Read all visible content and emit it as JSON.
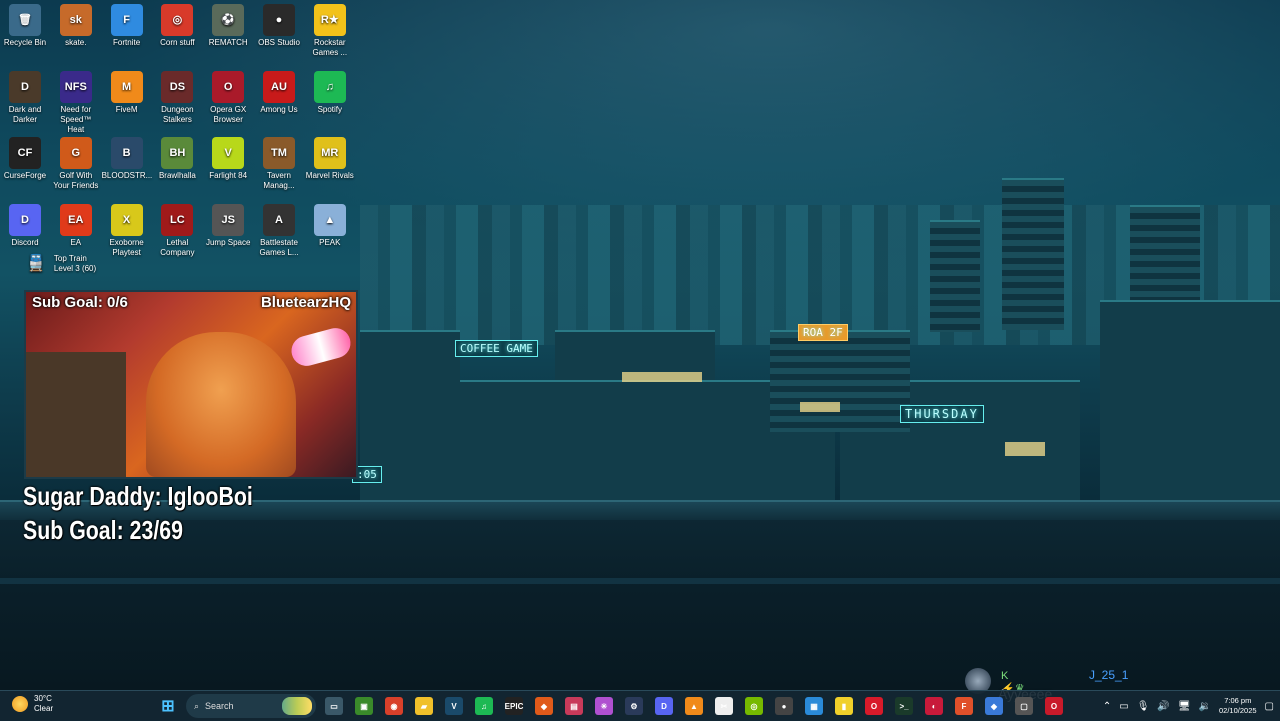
{
  "desktop": {
    "icons": [
      {
        "label": "Recycle Bin",
        "glyph": "🗑",
        "color": "#3a6a8a"
      },
      {
        "label": "skate.",
        "glyph": "sk",
        "color": "#c66a2a"
      },
      {
        "label": "Fortnite",
        "glyph": "F",
        "color": "#2f8be0"
      },
      {
        "label": "Corn stuff",
        "glyph": "◎",
        "color": "#d83a2a"
      },
      {
        "label": "REMATCH",
        "glyph": "⚽",
        "color": "#5a6a5a"
      },
      {
        "label": "OBS Studio",
        "glyph": "●",
        "color": "#2a2a2a"
      },
      {
        "label": "Rockstar Games ...",
        "glyph": "R★",
        "color": "#f2c21a"
      },
      {
        "label": "Dark and Darker",
        "glyph": "D",
        "color": "#4a3a2a"
      },
      {
        "label": "Need for Speed™ Heat",
        "glyph": "NFS",
        "color": "#3a2a8a"
      },
      {
        "label": "FiveM",
        "glyph": "M",
        "color": "#f08a1a"
      },
      {
        "label": "Dungeon Stalkers",
        "glyph": "DS",
        "color": "#6a2a2a"
      },
      {
        "label": "Opera GX Browser",
        "glyph": "O",
        "color": "#aa1a2a"
      },
      {
        "label": "Among Us",
        "glyph": "AU",
        "color": "#c81a1a"
      },
      {
        "label": "Spotify",
        "glyph": "♫",
        "color": "#1db954"
      },
      {
        "label": "CurseForge",
        "glyph": "CF",
        "color": "#222"
      },
      {
        "label": "Golf With Your Friends",
        "glyph": "G",
        "color": "#d05a1a"
      },
      {
        "label": "BLOODSTR...",
        "glyph": "B",
        "color": "#2a4a6a"
      },
      {
        "label": "Brawlhalla",
        "glyph": "BH",
        "color": "#5a8a3a"
      },
      {
        "label": "Farlight 84",
        "glyph": "V",
        "color": "#b8d81a"
      },
      {
        "label": "Tavern Manag...",
        "glyph": "TM",
        "color": "#8a5a2a"
      },
      {
        "label": "Marvel Rivals",
        "glyph": "MR",
        "color": "#e0c01a"
      },
      {
        "label": "Discord",
        "glyph": "D",
        "color": "#5865f2"
      },
      {
        "label": "EA",
        "glyph": "EA",
        "color": "#e03a1a"
      },
      {
        "label": "Exoborne Playtest",
        "glyph": "X",
        "color": "#d8c81a"
      },
      {
        "label": "Lethal Company",
        "glyph": "LC",
        "color": "#a01a1a"
      },
      {
        "label": "Jump Space",
        "glyph": "JS",
        "color": "#555"
      },
      {
        "label": "Battlestate Games L...",
        "glyph": "A",
        "color": "#333"
      },
      {
        "label": "PEAK",
        "glyph": "▲",
        "color": "#8ab0d8"
      }
    ],
    "top_train": "Top Train Level 3 (60)"
  },
  "wallpaper": {
    "signs": [
      "COFFEE GAME",
      "THURSDAY",
      "ROA 2F",
      ":05"
    ]
  },
  "stream_overlay": {
    "sub_goal_cam": "Sub Goal: 0/6",
    "streamer": "BluetearzHQ",
    "sugar_daddy": "Sugar Daddy: IglooBoi",
    "sub_goal": "Sub Goal: 23/69"
  },
  "chat": {
    "badges": "K ⚡♛",
    "username": "J_25_1",
    "message": "Ayyeeee"
  },
  "taskbar": {
    "weather_temp": "30°C",
    "weather_desc": "Clear",
    "search_label": "Search",
    "apps": [
      {
        "name": "task-view",
        "glyph": "▭",
        "color": "#3a5868"
      },
      {
        "name": "minecraft",
        "glyph": "▣",
        "color": "#3a8a2a"
      },
      {
        "name": "chrome",
        "glyph": "◉",
        "color": "#d8402a"
      },
      {
        "name": "file-explorer",
        "glyph": "▰",
        "color": "#f0c02a"
      },
      {
        "name": "vs",
        "glyph": "V",
        "color": "#1a4a6a"
      },
      {
        "name": "spotify",
        "glyph": "♫",
        "color": "#1db954"
      },
      {
        "name": "epic",
        "glyph": "EPIC",
        "color": "#222"
      },
      {
        "name": "brave",
        "glyph": "◆",
        "color": "#e05a1a"
      },
      {
        "name": "twitch-app",
        "glyph": "▤",
        "color": "#c83a5a"
      },
      {
        "name": "cursor",
        "glyph": "✳",
        "color": "#b050d0"
      },
      {
        "name": "steam",
        "glyph": "⚙",
        "color": "#2a3a5a"
      },
      {
        "name": "discord",
        "glyph": "D",
        "color": "#5865f2"
      },
      {
        "name": "vlc",
        "glyph": "▲",
        "color": "#f08a1a"
      },
      {
        "name": "capcut",
        "glyph": "✂",
        "color": "#eee"
      },
      {
        "name": "nvidia",
        "glyph": "◎",
        "color": "#76b900"
      },
      {
        "name": "obs",
        "glyph": "●",
        "color": "#444"
      },
      {
        "name": "snip",
        "glyph": "▦",
        "color": "#2a8ad8"
      },
      {
        "name": "sticky",
        "glyph": "▮",
        "color": "#f0d02a"
      },
      {
        "name": "opera",
        "glyph": "O",
        "color": "#d81a2a"
      },
      {
        "name": "terminal",
        "glyph": ">_",
        "color": "#1a3a2a"
      },
      {
        "name": "game-app",
        "glyph": "◐",
        "color": "#c81a3a"
      },
      {
        "name": "figma",
        "glyph": "F",
        "color": "#e0502a"
      },
      {
        "name": "diamond",
        "glyph": "◆",
        "color": "#3a7ad8"
      },
      {
        "name": "bag",
        "glyph": "▢",
        "color": "#555"
      },
      {
        "name": "opera-gx",
        "glyph": "O",
        "color": "#c81a2a"
      }
    ],
    "time": "7:06 pm",
    "date": "02/10/2025"
  }
}
